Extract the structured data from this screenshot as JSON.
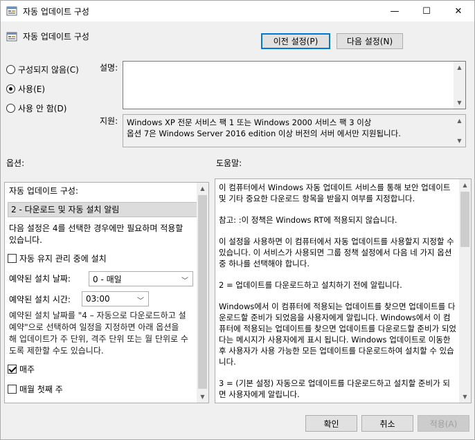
{
  "window": {
    "title": "자동 업데이트 구성",
    "minimize": "—",
    "maximize": "☐",
    "close": "✕"
  },
  "header": {
    "policy_name": "자동 업데이트 구성",
    "prev_button": "이전 설정(P)",
    "next_button": "다음 설정(N)"
  },
  "state": {
    "not_configured": "구성되지 않음(C)",
    "enabled": "사용(E)",
    "disabled": "사용 안 함(D)",
    "selected": "enabled"
  },
  "fields": {
    "comment_label": "설명:",
    "supported_label": "지원:",
    "supported_line1": "Windows XP 전문 서비스 팩 1 또는 Windows 2000 서비스 팩 3 이상",
    "supported_line2": "옵션 7은 Windows Server 2016 edition 이상 버전의 서버 에서만 지원됩니다."
  },
  "options": {
    "section_label": "옵션:",
    "configure_label": "자동 업데이트 구성:",
    "configure_value": "2 - 다운로드 및 자동 설치 알림",
    "note_line1": "다음 설정은 4를 선택한 경우에만 필요하며 적용할",
    "note_line2": "있습니다.",
    "maintenance_label": "자동 유지 관리 중에 설치",
    "day_label": "예약된 설치 날짜:",
    "day_value": "0 - 매일",
    "time_label": "예약된 설치 시간:",
    "time_value": "03:00",
    "sched_line1": "예약된 설치 날짜를 \"4 – 자동으로 다운로드하고 설",
    "sched_line2": "예약\"으로 선택하여 일정을 지정하면 아래 옵션을 ",
    "sched_line3": "해 업데이트가 주 단위, 격주 단위 또는 월 단위로 수",
    "sched_line4": "도록 제한할 수도 있습니다.",
    "weekly_label": "매주",
    "first_week_label": "매월 첫째 주"
  },
  "help": {
    "section_label": "도움말:",
    "p1": "이 컴퓨터에서 Windows 자동 업데이트 서비스를 통해 보안 업데이트 및 기타 중요한 다운로드 항목을 받을지 여부를 지정합니다.",
    "p2": "참고: :이 정책은 Windows RT에 적용되지 않습니다.",
    "p3": "이 설정을 사용하면 이 컴퓨터에서 자동 업데이트를 사용할지 지정할 수 있습니다. 이 서비스가 사용되면 그룹 정책 설정에서 다음 네 가지 옵션 중 하나를 선택해야 합니다.",
    "p4": " 2 = 업데이트를 다운로드하고 설치하기 전에 알립니다.",
    "p5": " Windows에서 이 컴퓨터에 적용되는 업데이트를 찾으면 업데이트를 다운로드할 준비가 되었음을 사용자에게 알립니다. Windows에서 이 컴퓨터에 적용되는 업데이트를 찾으면 업데이트를 다운로드할 준비가 되었다는 메시지가 사용자에게 표시 됩니다. Windows 업데이트로 이동한 후 사용자가 사용 가능한 모든 업데이트를 다운로드하여 설치할 수 있습니다.",
    "p6": " 3 = (기본 설정) 자동으로 업데이트를 다운로드하고 설치할 준비가 되면 사용자에게 알립니다."
  },
  "footer": {
    "ok": "확인",
    "cancel": "취소",
    "apply": "적용(A)"
  }
}
